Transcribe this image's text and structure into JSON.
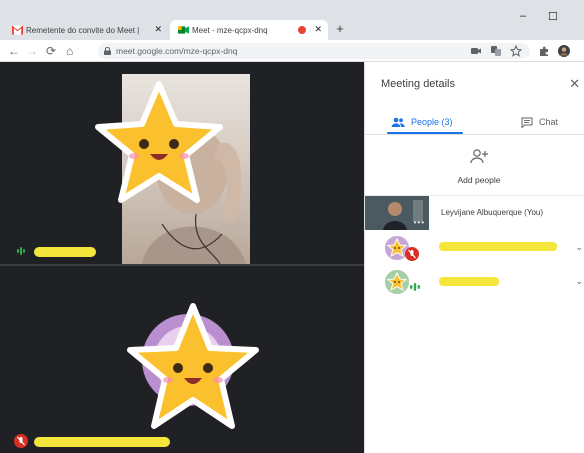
{
  "browser": {
    "tabs": [
      {
        "title": "Remetente do convite do Meet |",
        "favicon": "gmail-icon"
      },
      {
        "title": "Meet - mze-qcpx-dnq",
        "favicon": "meet-icon",
        "recording": true
      }
    ],
    "new_tab_symbol": "+",
    "close_symbol": "✕",
    "window_controls": {
      "minimize": "–",
      "maximize": "☐"
    },
    "nav": {
      "back": "←",
      "forward": "→",
      "reload": "⟳",
      "home": "⌂"
    },
    "url": "meet.google.com/mze-qcpx-dnq"
  },
  "meeting": {
    "tiles": [
      {
        "kind": "camera",
        "sticker": "star-face",
        "name_redacted": true,
        "audio": "speaking"
      },
      {
        "kind": "avatar",
        "sticker": "star-face",
        "name_redacted": true,
        "audio": "muted"
      }
    ]
  },
  "panel": {
    "title": "Meeting details",
    "close_symbol": "✕",
    "tabs": {
      "people_label": "People (3)",
      "chat_label": "Chat"
    },
    "add_people_label": "Add people",
    "self": {
      "name": "Leyvijane Albuquerque (You)",
      "more": "•••"
    },
    "participants": [
      {
        "status": "muted",
        "name_redacted": true,
        "chevron": "⌄"
      },
      {
        "status": "speaking",
        "name_redacted": true,
        "chevron": "⌄"
      }
    ]
  },
  "colors": {
    "accent": "#1a73e8",
    "stage": "#202124",
    "mute_red": "#d93025",
    "speaking_green": "#34a853",
    "redaction": "#f4e63b",
    "sticker_yellow": "#fbc02d"
  }
}
